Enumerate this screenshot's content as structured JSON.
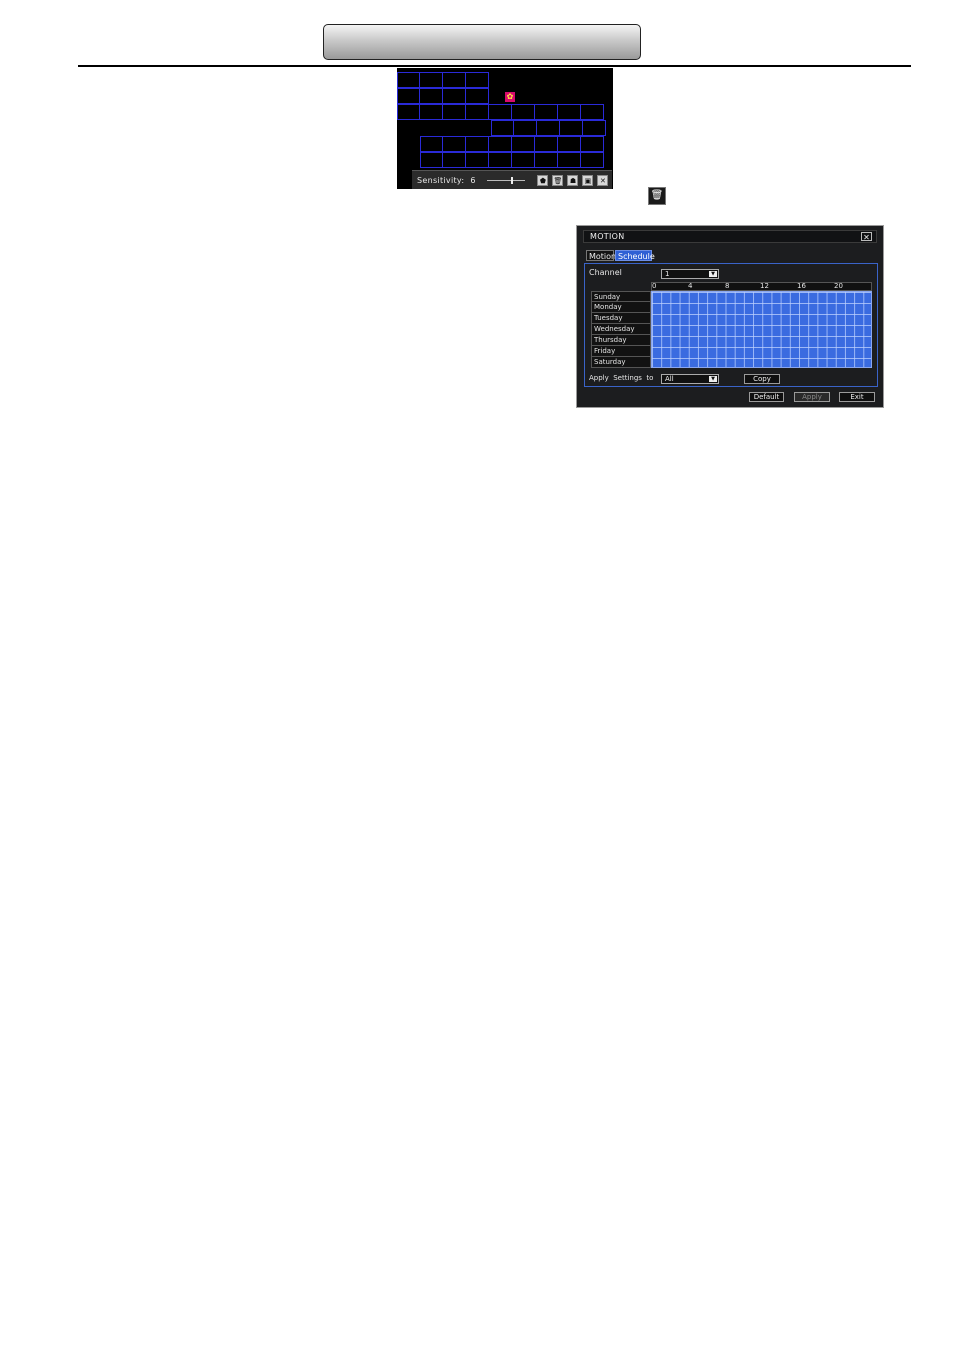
{
  "preview": {
    "sensitivity_label": "Sensitivity:",
    "sensitivity_value": "6",
    "motion_marker_glyph": "✿",
    "toolbar_icons": [
      "all-area-icon",
      "clear-icon",
      "test-icon",
      "save-icon",
      "close-icon"
    ],
    "toolbar_glyphs": [
      "⬟",
      "🗑",
      "☗",
      "▣",
      "✕"
    ]
  },
  "standalone_icon": {
    "name": "trash-icon",
    "glyph": "🗑"
  },
  "dialog": {
    "title": "MOTION",
    "close_glyph": "✕",
    "tabs": [
      {
        "label": "Motion",
        "active": false
      },
      {
        "label": "Schedule",
        "active": true
      }
    ],
    "channel_label": "Channel",
    "channel_value": "1",
    "hour_labels": [
      "0",
      "4",
      "8",
      "12",
      "16",
      "20"
    ],
    "days": [
      "Sunday",
      "Monday",
      "Tuesday",
      "Wednesday",
      "Thursday",
      "Friday",
      "Saturday"
    ],
    "apply_settings_label": "Apply  Settings  to",
    "apply_settings_value": "All",
    "copy_label": "Copy",
    "buttons": {
      "default": "Default",
      "apply": "Apply",
      "exit": "Exit"
    },
    "colors": {
      "schedule_fill": "#3a6be0",
      "active_tab": "#2e5fd4"
    }
  }
}
